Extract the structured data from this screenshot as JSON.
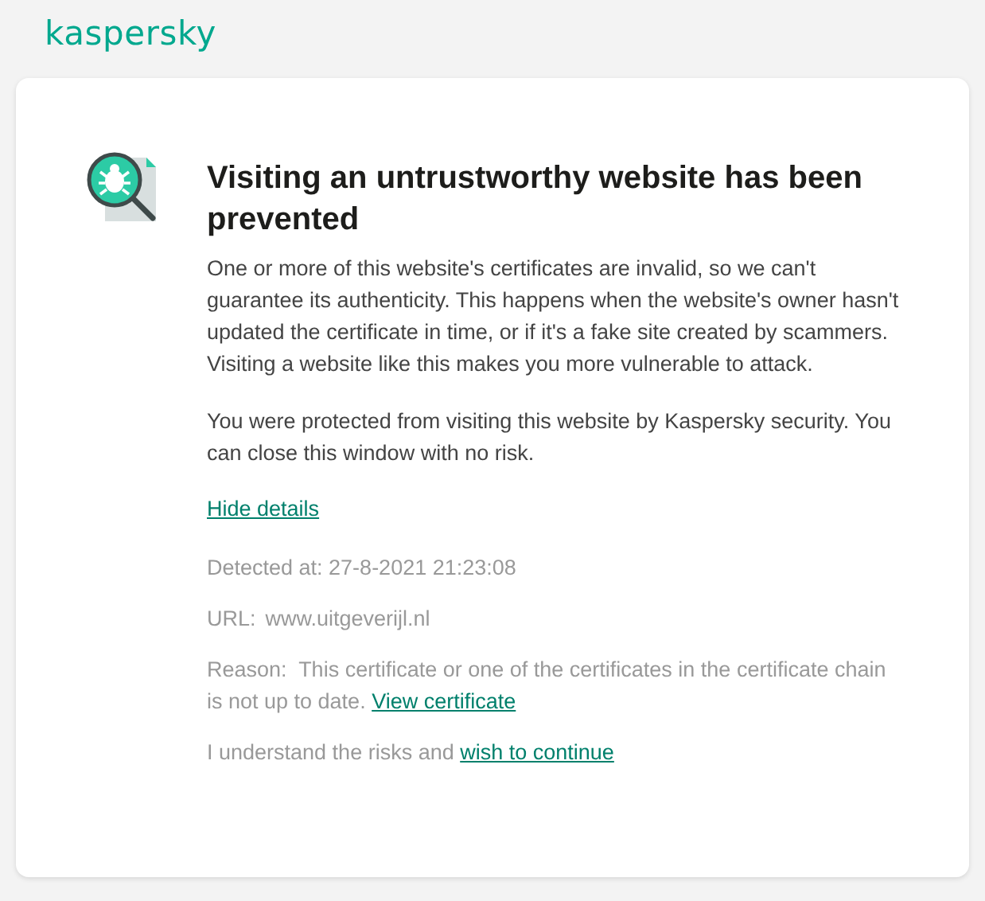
{
  "brand": "kaspersky",
  "title": "Visiting an untrustworthy website has been prevented",
  "paragraphs": [
    "One or more of this website's certificates are invalid, so we can't guarantee its authenticity. This happens when the website's owner hasn't updated the certificate in time, or if it's a fake site created by scammers. Visiting a website like this makes you more vulnerable to attack.",
    "You were protected from visiting this website by Kaspersky security. You can close this window with no risk."
  ],
  "details_link": "Hide details",
  "detected": "Detected at: 27-8-2021 21:23:08",
  "url": {
    "label": "URL:",
    "value": "www.uitgeverijl.nl"
  },
  "reason": {
    "label": "Reason:",
    "text": "This certificate or one of the certificates in the certificate chain is not up to date.",
    "link": "View certificate"
  },
  "continue": {
    "text": "I understand the risks and",
    "link": "wish to continue"
  }
}
